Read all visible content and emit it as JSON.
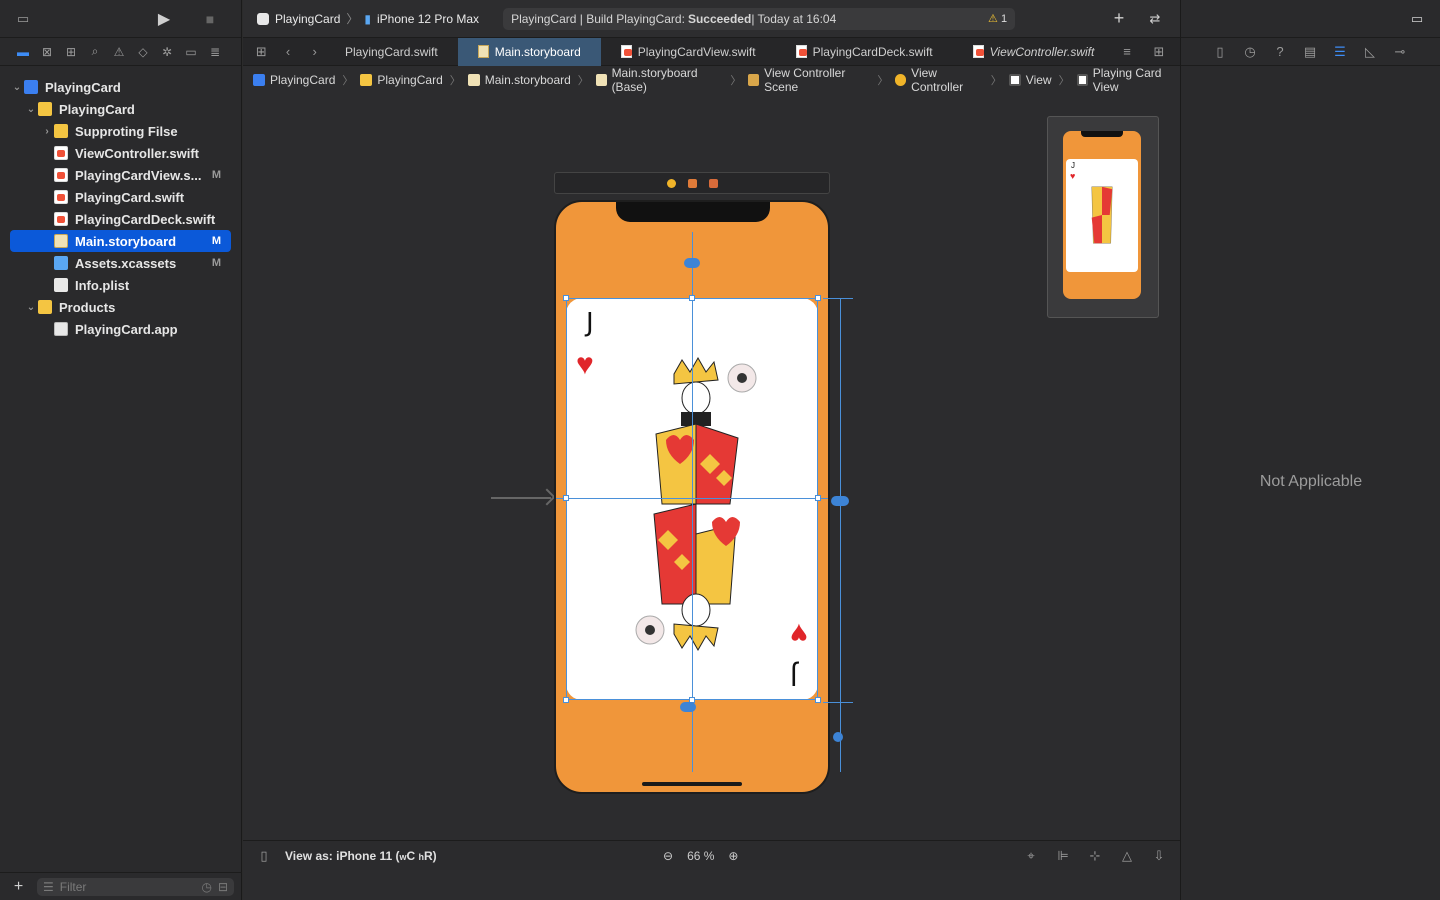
{
  "toolbar": {
    "scheme_project": "PlayingCard",
    "scheme_device": "iPhone 12 Pro Max",
    "status_text": "PlayingCard | Build PlayingCard: ",
    "status_result": "Succeeded",
    "status_time": " | Today at 16:04",
    "warning_count": "1"
  },
  "navigator": {
    "items": [
      {
        "label": "PlayingCard",
        "badge": ""
      },
      {
        "label": "PlayingCard",
        "badge": ""
      },
      {
        "label": "Supproting Filse",
        "badge": ""
      },
      {
        "label": "ViewController.swift",
        "badge": ""
      },
      {
        "label": "PlayingCardView.s...",
        "badge": "M"
      },
      {
        "label": "PlayingCard.swift",
        "badge": ""
      },
      {
        "label": "PlayingCardDeck.swift",
        "badge": ""
      },
      {
        "label": "Main.storyboard",
        "badge": "M"
      },
      {
        "label": "Assets.xcassets",
        "badge": "M"
      },
      {
        "label": "Info.plist",
        "badge": ""
      },
      {
        "label": "Products",
        "badge": ""
      },
      {
        "label": "PlayingCard.app",
        "badge": ""
      }
    ],
    "filter_placeholder": "Filter"
  },
  "tabs": [
    {
      "label": "PlayingCard.swift"
    },
    {
      "label": "Main.storyboard"
    },
    {
      "label": "PlayingCardView.swift"
    },
    {
      "label": "PlayingCardDeck.swift"
    },
    {
      "label": "ViewController.swift"
    }
  ],
  "jumpbar": [
    "PlayingCard",
    "PlayingCard",
    "Main.storyboard",
    "Main.storyboard (Base)",
    "View Controller Scene",
    "View Controller",
    "View",
    "Playing Card View"
  ],
  "card": {
    "rank": "J",
    "suit": "♥"
  },
  "canvas_bottom": {
    "view_as": "View as: iPhone 11 (",
    "view_as_w": "w",
    "view_as_c": "C ",
    "view_as_h": "h",
    "view_as_r": "R)",
    "zoom": "66 %"
  },
  "inspector": {
    "message": "Not Applicable"
  },
  "colors": {
    "accent": "#0b59d9",
    "phone_bg": "#f0963a",
    "suit_red": "#e0262a"
  }
}
